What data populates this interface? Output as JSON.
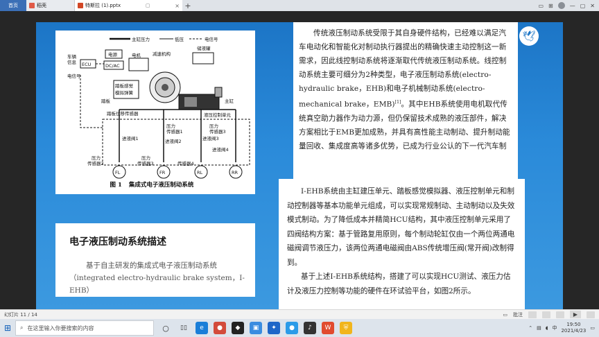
{
  "tabbar": {
    "home_label": "首页",
    "tabs": [
      {
        "label": "稻壳"
      },
      {
        "label": "特斯拉 (1).pptx"
      }
    ]
  },
  "figure": {
    "caption_num": "图 1",
    "caption_text": "集成式电子液压制动系统",
    "legend": [
      "主缸压力",
      "低压",
      "电信号"
    ],
    "labels": {
      "vehicle_info": "车辆",
      "vehicle_info2": "信息",
      "ecu": "ECU",
      "power": "电源",
      "dcac": "DC/AC",
      "motor": "电机",
      "reducer": "减速机构",
      "reservoir": "储液罐",
      "pedal_sim": "踏板感觉",
      "pedal_sim2": "模拟弹簧",
      "master_cyl": "主缸",
      "pedal": "踏板",
      "pedal_sensor": "踏板位移传感器",
      "signal": "电信号",
      "hcu": "液压控制单元",
      "inlet1": "进液阀1",
      "inlet2": "进液阀2",
      "inlet3": "进液阀3",
      "inlet4": "进液阀4",
      "ps1a": "压力",
      "ps1b": "传感器1",
      "ps2a": "压力",
      "ps2b": "传感器2",
      "ps3a": "压力",
      "ps3b": "传感器3",
      "ps4a": "压力",
      "ps4b": "传感器4",
      "w1": "FL",
      "w2": "FR",
      "w3": "RL",
      "w4": "RR"
    }
  },
  "para1": "传统液压制动系统受限于其自身硬件结构，已经难以满足汽车电动化和智能化对制动执行器提出的精确快速主动控制这一新需求，因此线控制动系统将逐渐取代传统液压制动系统。线控制动系统主要可细分为2种类型，电子液压制动系统(electro-hydraulic brake，EHB)和电子机械制动系统(electro-mechanical brake，EMB)",
  "para1_ref": "[1]",
  "para1_tail": "。其中EHB系统使用电机取代传统真空助力器作为动力源，但仍保留技术成熟的液压部件，解决方案相比于EMB更加成熟，并具有高性能主动制动、提升制动能量回收、集成度高等诸多优势，已成为行业公认的下一代汽车制",
  "para2": {
    "p1": "I-EHB系统由主缸建压单元、踏板感觉模拟器、液压控制单元和制动控制器等基本功能单元组成，可以实现常规制动、主动制动以及失效模式制动。为了降低成本并精简HCU结构，其中液压控制单元采用了四阀结构方案：基于管路复用原则，每个制动轮缸仅由一个两位两通电磁阀调节液压力，该两位两通电磁阀由ABS传统增压阀(常开阀)改制得到。",
    "p2": "基于上述I-EHB系统结构，搭建了可以实现HCU测试、液压力估计及液压力控制等功能的硬件在环试验平台，如图2所示。"
  },
  "desc": {
    "title": "电子液压制动系统描述",
    "body": "基于自主研发的集成式电子液压制动系统",
    "body2": "（integrated electro-hydraulic brake system，I-EHB）"
  },
  "statusbar": {
    "slide_info": "幻灯片 11 / 14",
    "note_label": "批注"
  },
  "taskbar": {
    "search_placeholder": "在这里输入你要搜索的内容",
    "time": "19:50",
    "date": "2021/4/23",
    "ime": "中"
  }
}
